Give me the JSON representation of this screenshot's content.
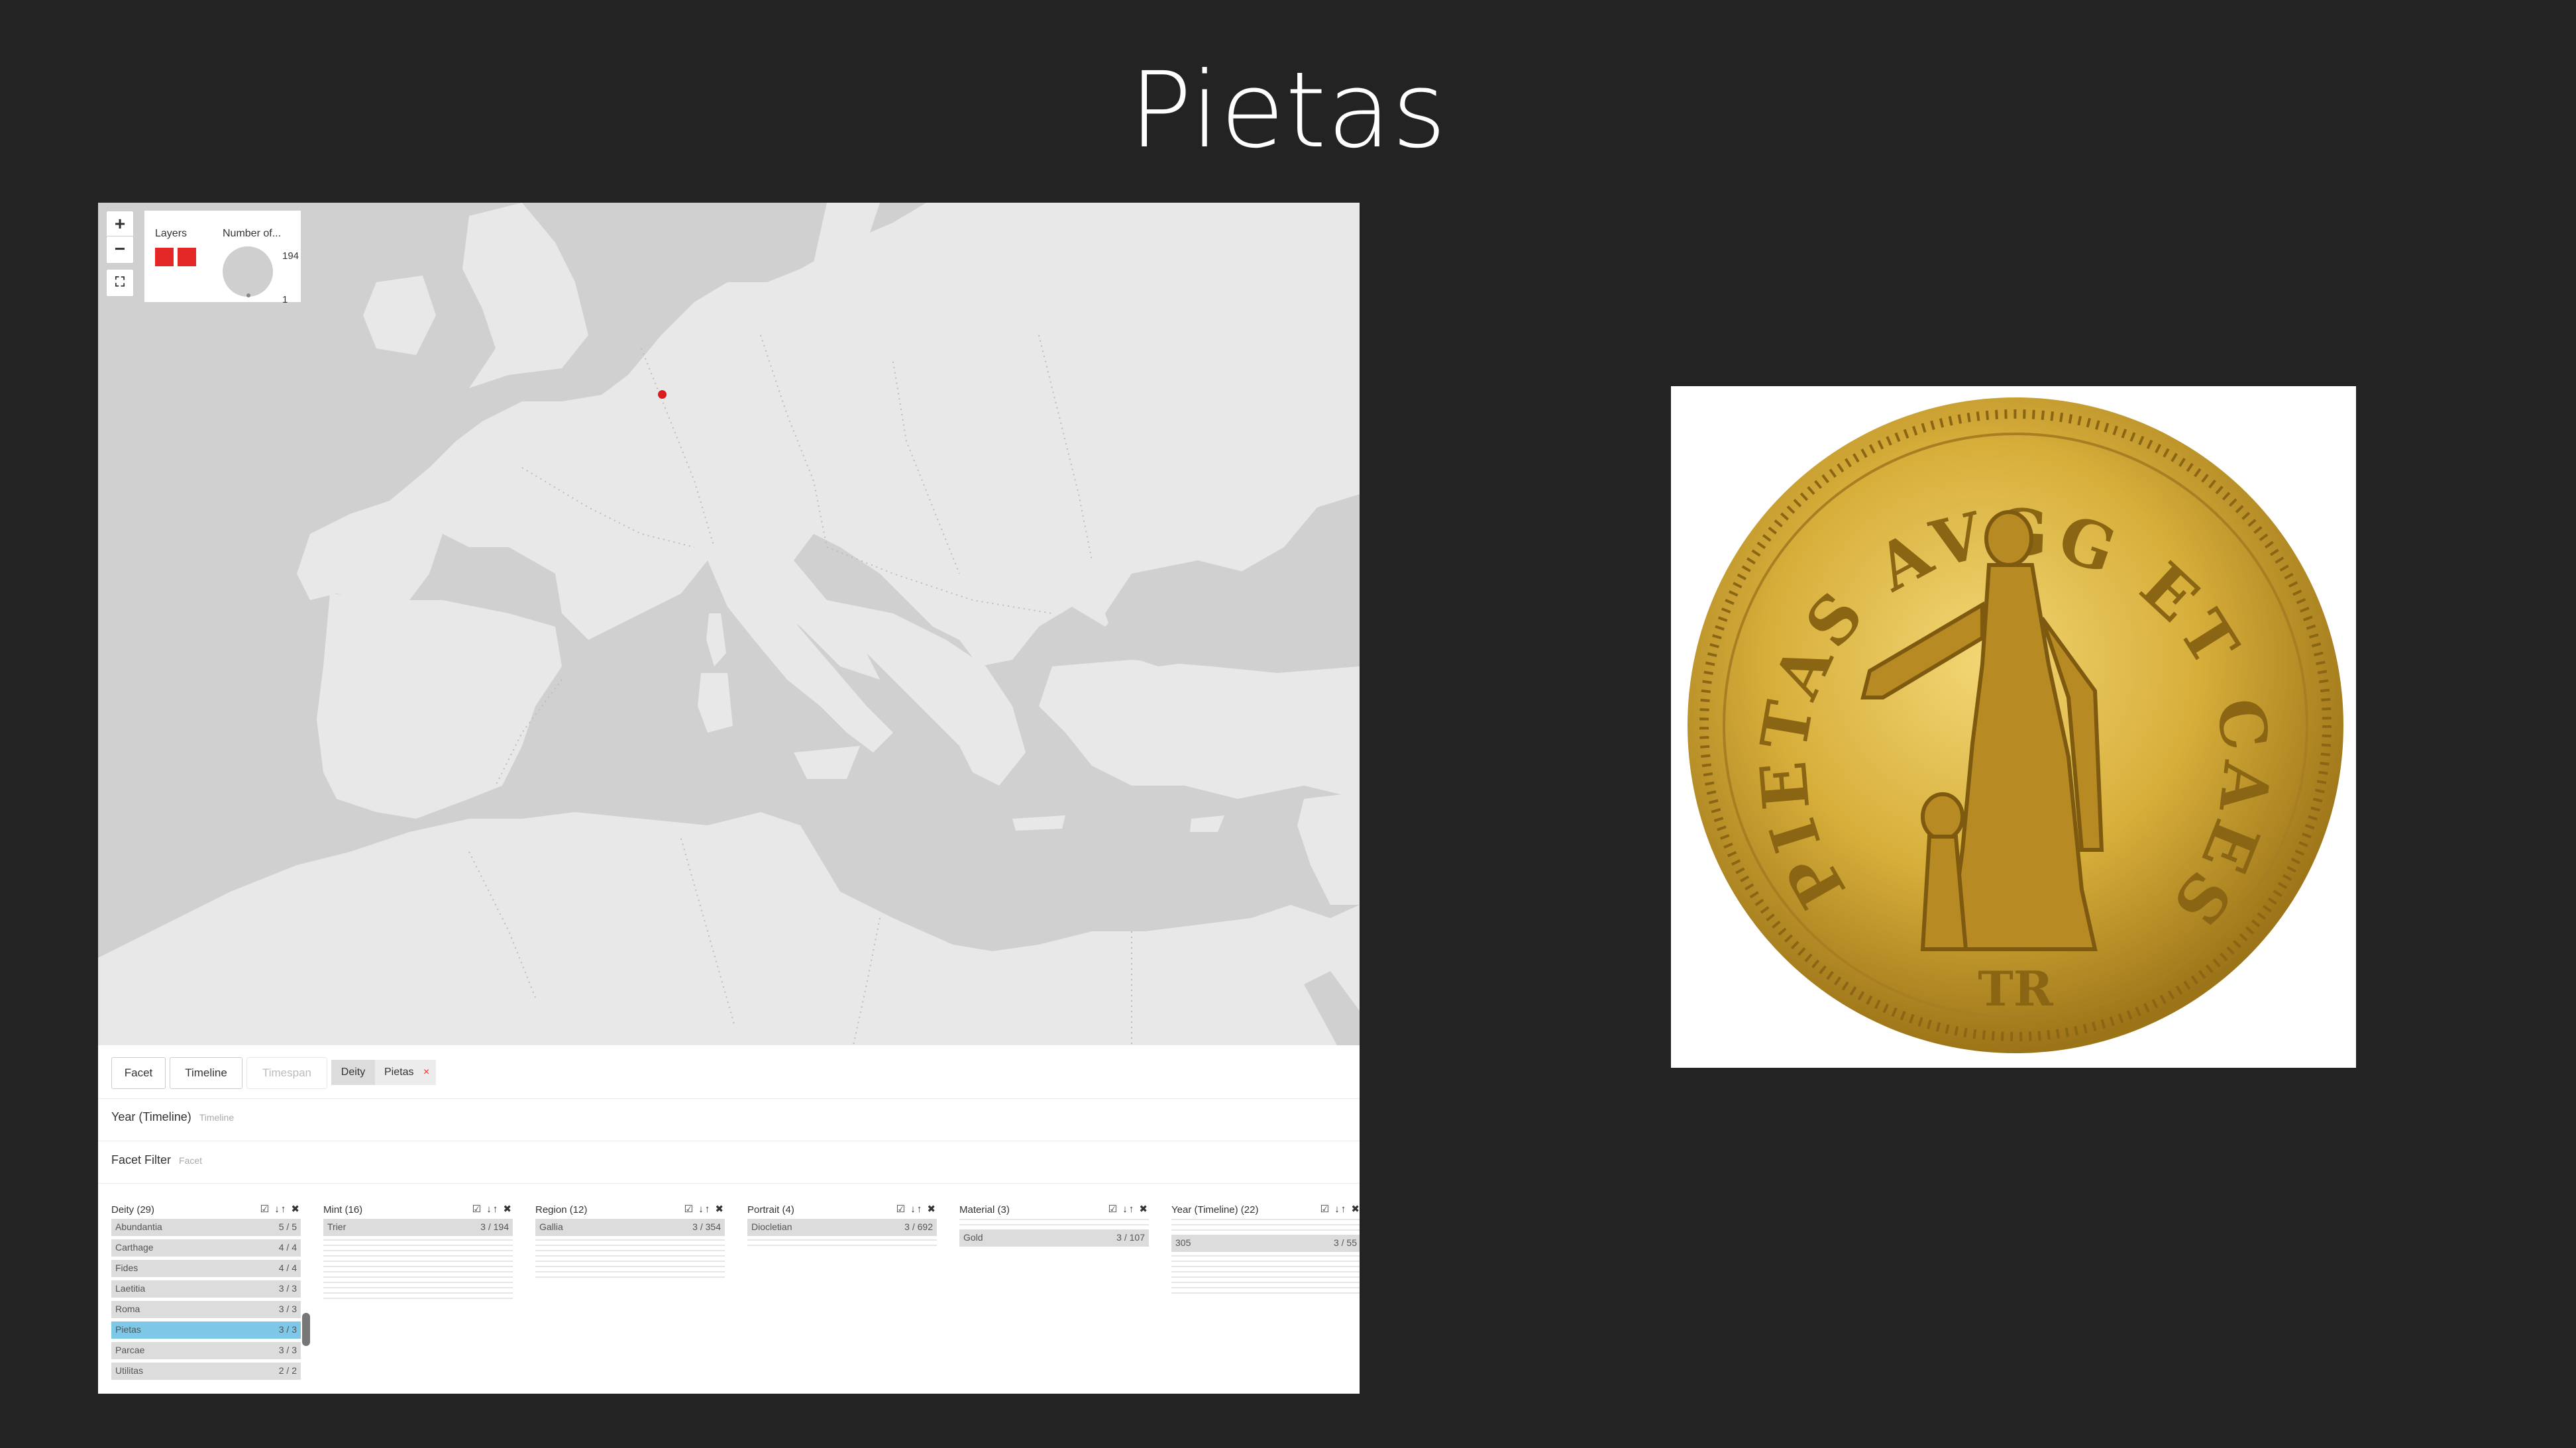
{
  "slide": {
    "title": "Pietas"
  },
  "map": {
    "zoom_in": "+",
    "zoom_out": "−",
    "legend": {
      "layers_label": "Layers",
      "number_label": "Number of...",
      "max_value": "194",
      "min_value": "1",
      "layer_color": "#e32626"
    },
    "point_color": "#d81e1e"
  },
  "toolbar": {
    "tabs": [
      {
        "label": "Facet",
        "enabled": true
      },
      {
        "label": "Timeline",
        "enabled": true
      },
      {
        "label": "Timespan",
        "enabled": false
      }
    ],
    "active_filter": {
      "field": "Deity",
      "value": "Pietas",
      "remove": "×"
    }
  },
  "sections": {
    "timeline": {
      "title": "Year (Timeline)",
      "hint": "Timeline"
    },
    "facet_filter": {
      "title": "Facet Filter",
      "hint": "Facet"
    }
  },
  "facet_controls": "☑ ↓↑ ✖",
  "facets": [
    {
      "title": "Deity (29)",
      "rows": [
        {
          "name": "Abundantia",
          "count": "5 / 5"
        },
        {
          "name": "Carthage",
          "count": "4 / 4"
        },
        {
          "name": "Fides",
          "count": "4 / 4"
        },
        {
          "name": "Laetitia",
          "count": "3 / 3"
        },
        {
          "name": "Roma",
          "count": "3 / 3"
        },
        {
          "name": "Pietas",
          "count": "3 / 3",
          "selected": true
        },
        {
          "name": "Parcae",
          "count": "3 / 3"
        },
        {
          "name": "Utilitas",
          "count": "2 / 2"
        }
      ]
    },
    {
      "title": "Mint (16)",
      "rows": [
        {
          "name": "Trier",
          "count": "3 / 194"
        }
      ]
    },
    {
      "title": "Region (12)",
      "rows": [
        {
          "name": "Gallia",
          "count": "3 / 354"
        }
      ]
    },
    {
      "title": "Portrait (4)",
      "rows": [
        {
          "name": "Diocletian",
          "count": "3 / 692"
        }
      ]
    },
    {
      "title": "Material (3)",
      "rows": [
        {
          "name": "Gold",
          "count": "3 / 107"
        }
      ]
    },
    {
      "title": "Year (Timeline) (22)",
      "rows": [
        {
          "name": "305",
          "count": "3 / 55"
        }
      ]
    }
  ],
  "coin": {
    "legend": "PIETAS AVGG ET CAESS NN",
    "exergue": "TR",
    "gold": "#d9b33c"
  }
}
